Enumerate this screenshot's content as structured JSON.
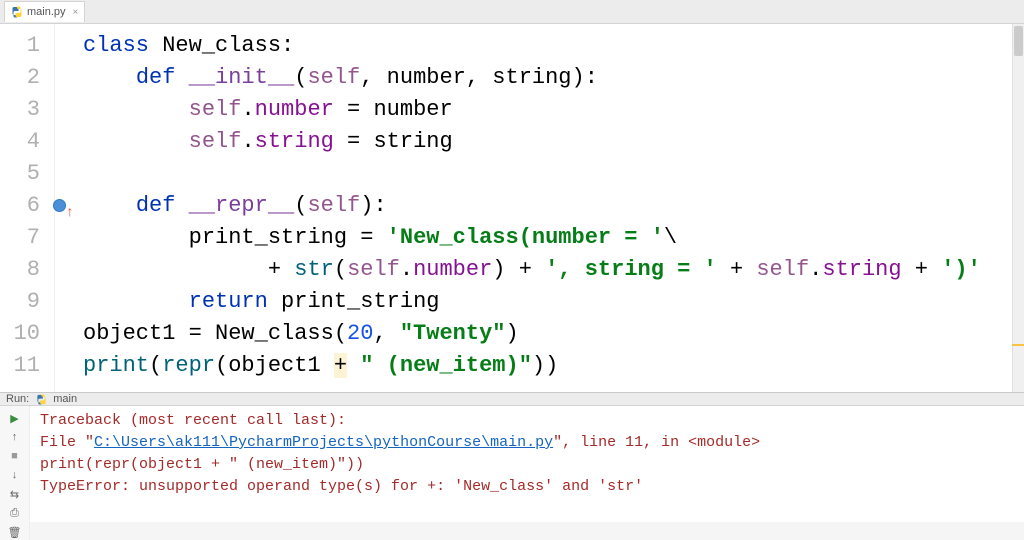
{
  "tab": {
    "filename": "main.py"
  },
  "gutter": {
    "lines": [
      "1",
      "2",
      "3",
      "4",
      "5",
      "6",
      "7",
      "8",
      "9",
      "10",
      "11"
    ],
    "breakpoint_line": 6
  },
  "code": {
    "l1": {
      "kw": "class",
      "name": "New_class",
      "tail": ":"
    },
    "l2": {
      "kw": "def",
      "name": "__init__",
      "params_open": "(",
      "self": "self",
      "rest": ", number, string):"
    },
    "l3": {
      "self": "self",
      "dot": ".",
      "field": "number",
      "rest": " = number"
    },
    "l4": {
      "self": "self",
      "dot": ".",
      "field": "string",
      "rest": " = string"
    },
    "l6": {
      "kw": "def",
      "name": "__repr__",
      "params_open": "(",
      "self": "self",
      "rest": "):"
    },
    "l7": {
      "lhs": "print_string = ",
      "str": "'New_class(number = '",
      "cont": "\\"
    },
    "l8": {
      "plus": "+ ",
      "fn": "str",
      "open": "(",
      "self": "self",
      "dot": ".",
      "field": "number",
      "close": ") + ",
      "str1": "', string = '",
      "plus2": " + ",
      "self2": "self",
      "dot2": ".",
      "field2": "string",
      "plus3": " + ",
      "str2": "')'"
    },
    "l9": {
      "kw": "return",
      "rest": " print_string"
    },
    "l10": {
      "lhs": "object1 = New_class(",
      "num": "20",
      "comma": ", ",
      "str": "\"Twenty\"",
      "close": ")"
    },
    "l11": {
      "fn1": "print",
      "open1": "(",
      "fn2": "repr",
      "open2": "(object1 ",
      "hl": "+",
      "sp": " ",
      "str": "\" (new_item)\"",
      "close": "))"
    }
  },
  "run": {
    "label": "Run:",
    "config": "main",
    "console": {
      "l1": "Traceback (most recent call last):",
      "l2_pre": "  File \"",
      "l2_link": "C:\\Users\\ak111\\PycharmProjects\\pythonCourse\\main.py",
      "l2_post": "\", line 11, in <module>",
      "l3": "    print(repr(object1 + \" (new_item)\"))",
      "l4": "TypeError: unsupported operand type(s) for +: 'New_class' and 'str'"
    }
  }
}
